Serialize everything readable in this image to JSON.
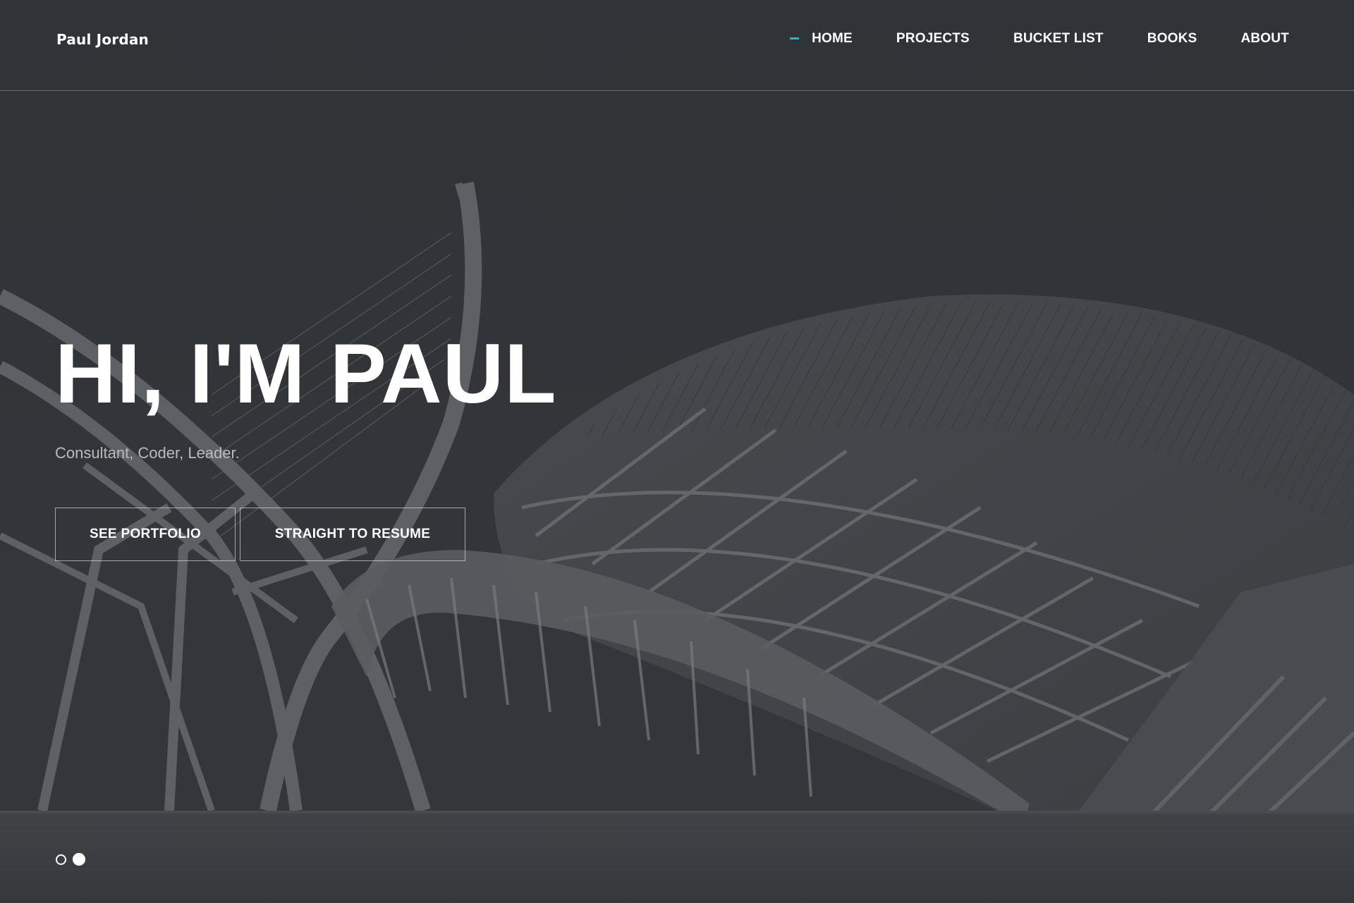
{
  "header": {
    "brand": "Paul Jordan",
    "nav": [
      {
        "label": "HOME",
        "active": true
      },
      {
        "label": "PROJECTS",
        "active": false
      },
      {
        "label": "BUCKET LIST",
        "active": false
      },
      {
        "label": "BOOKS",
        "active": false
      },
      {
        "label": "ABOUT",
        "active": false
      }
    ]
  },
  "hero": {
    "title": "HI, I'M PAUL",
    "subtitle": "Consultant, Coder, Leader.",
    "buttons": {
      "portfolio": "SEE PORTFOLIO",
      "resume": "STRAIGHT TO RESUME"
    },
    "background_image": "grayscale-futuristic-dome-architecture"
  },
  "slider": {
    "slide_count": 2,
    "active_index": 1
  },
  "colors": {
    "accent": "#1fb7d1",
    "overlay": "#2f3236",
    "text": "#ffffff",
    "subtitle": "#b9bbbe"
  }
}
